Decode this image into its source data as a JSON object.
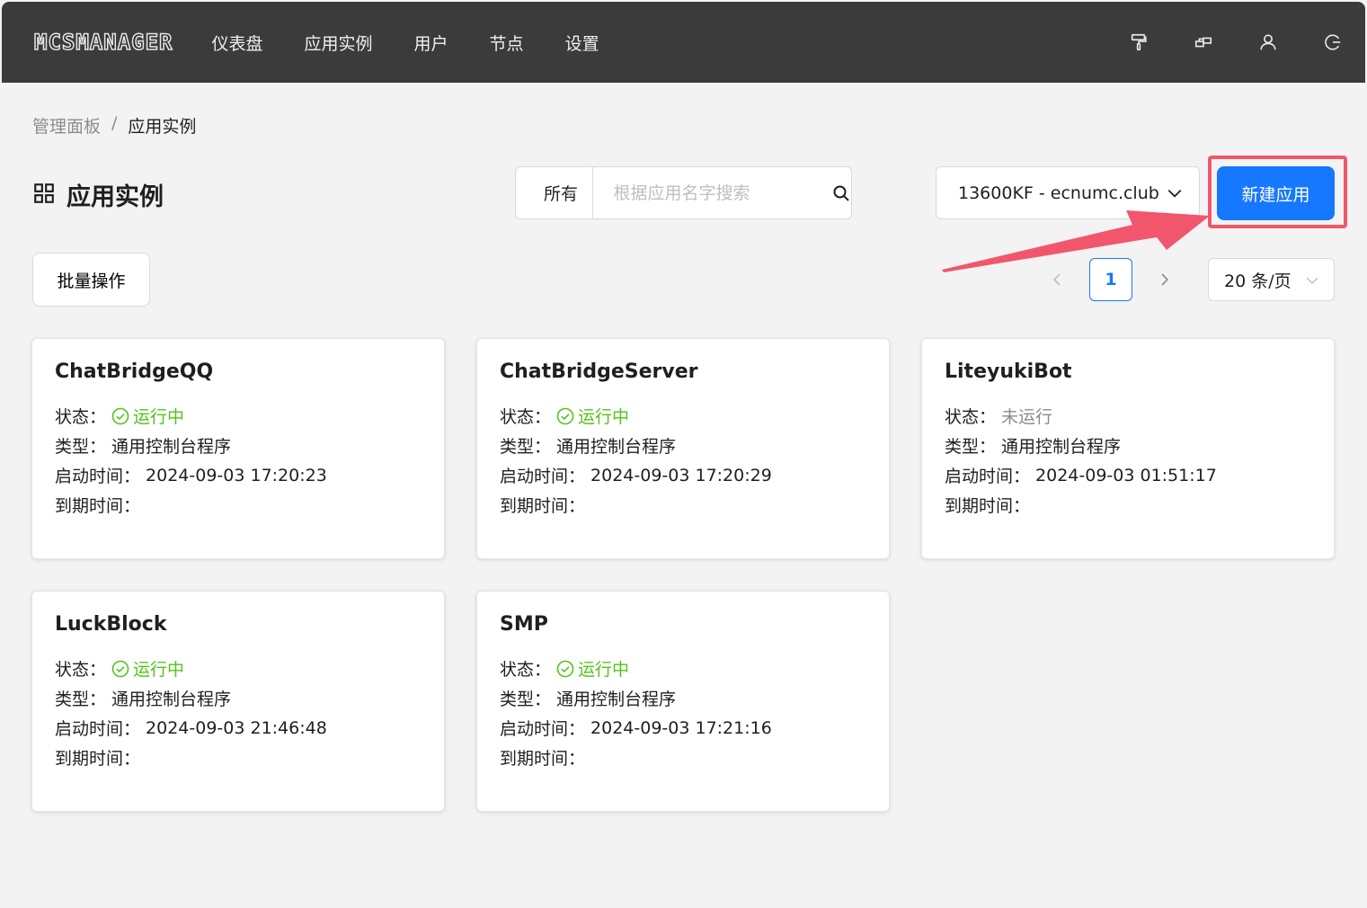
{
  "header": {
    "logo": "MCSMANAGER",
    "nav": [
      "仪表盘",
      "应用实例",
      "用户",
      "节点",
      "设置"
    ],
    "icons": [
      "paint-roller-icon",
      "layout-icon",
      "user-icon",
      "logout-icon"
    ]
  },
  "breadcrumb": {
    "root": "管理面板",
    "separator": "/",
    "current": "应用实例"
  },
  "toolbar": {
    "title": "应用实例",
    "filter_value": "所有",
    "search_placeholder": "根据应用名字搜索",
    "node_value": "13600KF - ecnumc.club",
    "new_button": "新建应用",
    "batch_button": "批量操作"
  },
  "pagination": {
    "current_page": "1",
    "page_size": "20 条/页"
  },
  "labels": {
    "status": "状态：",
    "type": "类型：",
    "start_time": "启动时间：",
    "expire_time": "到期时间："
  },
  "instances": [
    {
      "name": "ChatBridgeQQ",
      "status": "运行中",
      "running": true,
      "type": "通用控制台程序",
      "start_time": "2024-09-03 17:20:23",
      "expire_time": ""
    },
    {
      "name": "ChatBridgeServer",
      "status": "运行中",
      "running": true,
      "type": "通用控制台程序",
      "start_time": "2024-09-03 17:20:29",
      "expire_time": ""
    },
    {
      "name": "LiteyukiBot",
      "status": "未运行",
      "running": false,
      "type": "通用控制台程序",
      "start_time": "2024-09-03 01:51:17",
      "expire_time": ""
    },
    {
      "name": "LuckBlock",
      "status": "运行中",
      "running": true,
      "type": "通用控制台程序",
      "start_time": "2024-09-03 21:46:48",
      "expire_time": ""
    },
    {
      "name": "SMP",
      "status": "运行中",
      "running": true,
      "type": "通用控制台程序",
      "start_time": "2024-09-03 17:21:16",
      "expire_time": ""
    }
  ],
  "colors": {
    "topbar": "#3b3b3b",
    "primary": "#1677ff",
    "running": "#52c41a",
    "highlight": "#f2566d"
  }
}
